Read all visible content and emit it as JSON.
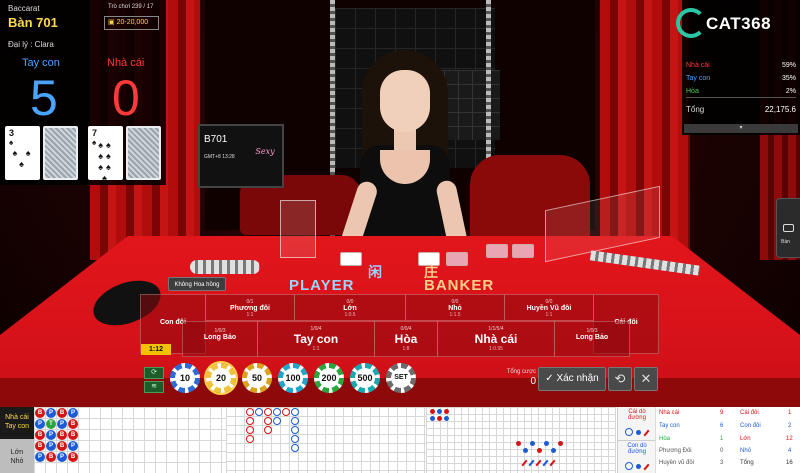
{
  "game": {
    "name": "Baccarat",
    "table": "Bàn 701",
    "round_label": "Trò chơi 239 / 17",
    "limit": "20-20,000",
    "dealer_label": "Đại lý : Clara"
  },
  "score": {
    "player_label": "Tay con",
    "banker_label": "Nhà cái",
    "player_value": "5",
    "banker_value": "0"
  },
  "cards": {
    "player": [
      {
        "rank": "3",
        "suit": "♠",
        "pips": "♠ ♠ ♠"
      }
    ],
    "banker": [
      {
        "rank": "7",
        "suit": "♠",
        "pips": "♠♠ ♠♠ ♠♠ ♠"
      }
    ]
  },
  "monitor": {
    "code": "B701",
    "gmt": "GMT+8 13:28",
    "brand": "Sexy"
  },
  "brand": {
    "logo_text": "CAT368",
    "logo_color": "#29c8a4"
  },
  "stats_right": {
    "rows": [
      {
        "label": "Nhà cái",
        "value": "59%",
        "color": "#ff3a3a"
      },
      {
        "label": "Tay con",
        "value": "35%",
        "color": "#4aa3ff"
      },
      {
        "label": "Hòa",
        "value": "2%",
        "color": "#3fd15a"
      }
    ],
    "total_label": "Tổng",
    "total_value": "22,175.6",
    "collapse_icon": "chevron-down-icon"
  },
  "side_tab": {
    "label": "Bàn",
    "icon": "chat-icon"
  },
  "table_labels": {
    "player": "PLAYER",
    "banker": "BANKER",
    "player_glyph": "闲",
    "banker_glyph": "庄"
  },
  "no_commission": "Không Hoa hồng",
  "bets": [
    {
      "id": "con-doi",
      "name": "Con đôi",
      "ratio": "",
      "count": ""
    },
    {
      "id": "phuong-doi",
      "name": "Phương đôi",
      "ratio": "1:1",
      "count": ""
    },
    {
      "id": "lon",
      "name": "Lớn",
      "ratio": "1:0.5",
      "count": "0/0"
    },
    {
      "id": "nho",
      "name": "Nhỏ",
      "ratio": "1:1.5",
      "count": ""
    },
    {
      "id": "huyen-vu-doi",
      "name": "Huyền Vũ đôi",
      "ratio": "1:1",
      "count": ""
    },
    {
      "id": "cai-doi",
      "name": "Cái đôi",
      "ratio": "",
      "count": ""
    },
    {
      "id": "long-bao-p",
      "name": "Long Bảo",
      "ratio": "",
      "count": "1/0/3"
    },
    {
      "id": "tay-con",
      "name": "Tay con",
      "ratio": "1:1",
      "count": "1/0/4"
    },
    {
      "id": "hoa",
      "name": "Hòa",
      "ratio": "1:8",
      "count": "0/0/4"
    },
    {
      "id": "nha-cai",
      "name": "Nhà cái",
      "ratio": "1:0.95",
      "count": "1/1/5/4"
    },
    {
      "id": "long-bao-b",
      "name": "Long Bảo",
      "ratio": "",
      "count": "1/0/3"
    }
  ],
  "ratio_badge": "1:12",
  "chips": [
    {
      "value": "10",
      "color": "#2c6bd8"
    },
    {
      "value": "20",
      "color": "#f0c43a"
    },
    {
      "value": "50",
      "color": "#d9a21d"
    },
    {
      "value": "100",
      "color": "#1fa6c9"
    },
    {
      "value": "200",
      "color": "#2aa63f"
    },
    {
      "value": "500",
      "color": "#17a8b0"
    },
    {
      "value": "SET",
      "color": "#6c6c6c"
    }
  ],
  "selected_chip": "20",
  "chip_icons": {
    "rebet": "refresh-icon",
    "signal": "wifi-icon"
  },
  "bet_summary": {
    "label": "Tổng cược",
    "value": "0"
  },
  "actions": {
    "confirm": "Xác nhận",
    "repeat_icon": "repeat-icon",
    "cancel_icon": "close-icon"
  },
  "roadmap": {
    "tabs": {
      "active": [
        "Nhà cái",
        "Tay con"
      ],
      "inactive": [
        "Lớn",
        "Nhỏ"
      ]
    },
    "bead_label": {
      "banker": "B",
      "player": "P",
      "tie": "T"
    },
    "colors": {
      "banker": "#d51515",
      "player": "#1b5bd6",
      "tie": "#2aa63f"
    },
    "predict": {
      "banker": [
        "Cái dò",
        "đường"
      ],
      "player": [
        "Con dò",
        "đường"
      ]
    },
    "stats": {
      "left": [
        {
          "label": "Nhà cái",
          "value": "9",
          "color": "#d51515"
        },
        {
          "label": "Tay con",
          "value": "6",
          "color": "#1b5bd6"
        },
        {
          "label": "Hòa",
          "value": "1",
          "color": "#2aa63f"
        },
        {
          "label": "Phương Đôi",
          "value": "0",
          "color": "#555555"
        },
        {
          "label": "Huyền vũ đôi",
          "value": "3",
          "color": "#555555"
        }
      ],
      "right": [
        {
          "label": "Cái đôi",
          "value": "1",
          "color": "#d51515"
        },
        {
          "label": "Con đôi",
          "value": "2",
          "color": "#1b5bd6"
        },
        {
          "label": "Lớn",
          "value": "12",
          "color": "#d51515"
        },
        {
          "label": "Nhỏ",
          "value": "4",
          "color": "#1b5bd6"
        },
        {
          "label": "Tổng",
          "value": "16",
          "color": "#333333"
        }
      ]
    }
  }
}
